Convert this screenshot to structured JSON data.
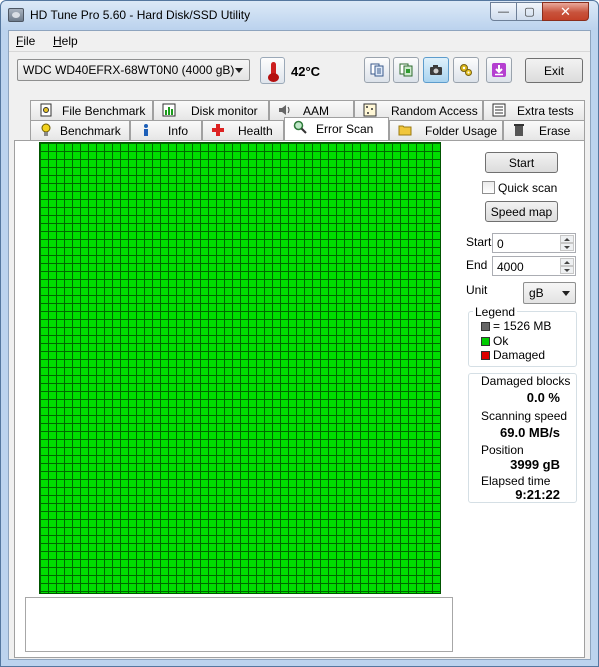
{
  "window": {
    "title": "HD Tune Pro 5.60 - Hard Disk/SSD Utility",
    "min_glyph": "—",
    "max_glyph": "▢",
    "close_glyph": "✕"
  },
  "menu": {
    "file": {
      "u": "F",
      "rest": "ile"
    },
    "help": {
      "u": "H",
      "rest": "elp"
    }
  },
  "toolbar": {
    "drive": "WDC WD40EFRX-68WT0N0 (4000 gB)",
    "temperature": "42°C",
    "exit_label": "Exit",
    "icons": [
      "copy-text-icon",
      "copy-screenshot-icon",
      "screenshot-camera-icon",
      "options-icon",
      "save-download-icon"
    ]
  },
  "tabs": {
    "row1": [
      "File Benchmark",
      "Disk monitor",
      "AAM",
      "Random Access",
      "Extra tests"
    ],
    "row2": [
      "Benchmark",
      "Info",
      "Health",
      "Error Scan",
      "Folder Usage",
      "Erase"
    ],
    "active": "Error Scan"
  },
  "scan": {
    "start_label": "Start",
    "quick_scan_label": "Quick scan",
    "quick_scan_checked": false,
    "speed_map_label": "Speed map",
    "start_field_label": "Start",
    "start_value": "0",
    "end_field_label": "End",
    "end_value": "4000",
    "unit_label": "Unit",
    "unit_value": "gB",
    "block_status": "ok",
    "log_text": ""
  },
  "legend": {
    "title": "Legend",
    "block": "= 1526 MB",
    "ok": "Ok",
    "damaged": "Damaged",
    "colors": {
      "block": "#666666",
      "ok": "#00cc00",
      "damaged": "#dd0000"
    }
  },
  "stats": {
    "damaged_blocks_label": "Damaged blocks",
    "damaged_blocks_value": "0.0 %",
    "scanning_speed_label": "Scanning speed",
    "scanning_speed_value": "69.0 MB/s",
    "position_label": "Position",
    "position_value": "3999 gB",
    "elapsed_label": "Elapsed time",
    "elapsed_value": "9:21:22"
  }
}
